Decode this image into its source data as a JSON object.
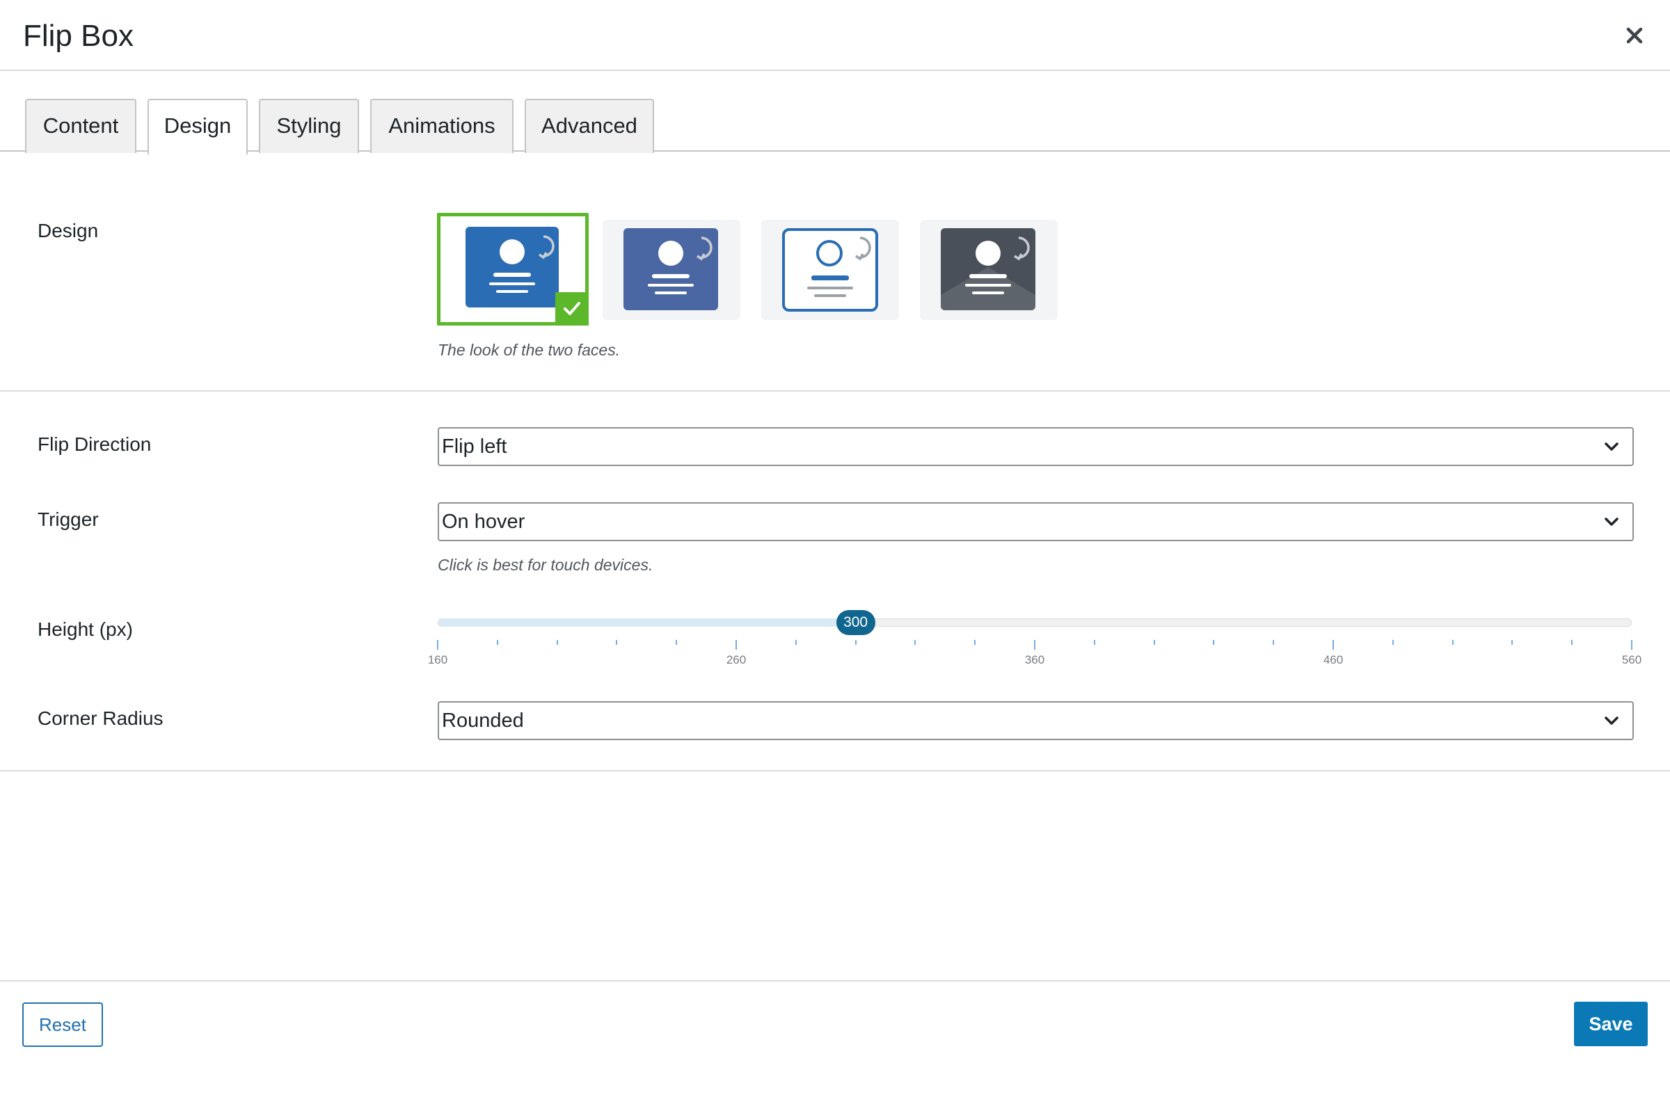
{
  "dialog": {
    "title": "Flip Box",
    "close_icon": "close-icon"
  },
  "tabs": [
    {
      "label": "Content",
      "active": false
    },
    {
      "label": "Design",
      "active": true
    },
    {
      "label": "Styling",
      "active": false
    },
    {
      "label": "Animations",
      "active": false
    },
    {
      "label": "Advanced",
      "active": false
    }
  ],
  "design": {
    "label": "Design",
    "hint": "The look of the two faces.",
    "selected_index": 0,
    "options": [
      {
        "icon": "card-solid-blue-icon",
        "color": "#2a6db5"
      },
      {
        "icon": "card-muted-blue-icon",
        "color": "#4a67a3"
      },
      {
        "icon": "card-outline-icon",
        "color": "#2a6db5"
      },
      {
        "icon": "card-dark-icon",
        "color": "#4a5059"
      }
    ]
  },
  "flip_direction": {
    "label": "Flip Direction",
    "value": "Flip left"
  },
  "trigger": {
    "label": "Trigger",
    "value": "On hover",
    "hint": "Click is best for touch devices."
  },
  "height": {
    "label": "Height (px)",
    "min": 160,
    "max": 560,
    "value": 300,
    "value_text": "300",
    "tick_labels": [
      "160",
      "260",
      "360",
      "460",
      "560"
    ]
  },
  "corner_radius": {
    "label": "Corner Radius",
    "value": "Rounded"
  },
  "footer": {
    "reset_label": "Reset",
    "save_label": "Save"
  },
  "colors": {
    "accent": "#0a79b6",
    "selected": "#5cb82a",
    "thumb": "#11668f"
  }
}
